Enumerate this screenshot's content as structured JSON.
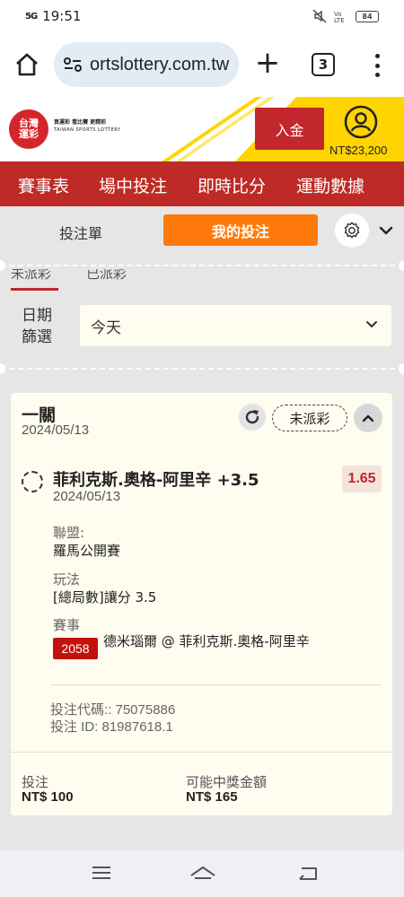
{
  "status_bar": {
    "signal": "5G",
    "time": "19:51",
    "battery": "84"
  },
  "browser": {
    "url": "ortslottery.com.tw",
    "tab_count": "3"
  },
  "header": {
    "logo_text": "台灣運彩",
    "tagline": "買運彩 看比賽 更精彩",
    "tagline_en": "TAIWAN SPORTS LOTTERY",
    "deposit_label": "入金",
    "balance": "NT$23,200"
  },
  "nav": {
    "items": [
      "賽事表",
      "場中投注",
      "即時比分",
      "運動數據"
    ]
  },
  "slip": {
    "bet_slip_label": "投注單",
    "my_bets_label": "我的投注",
    "subtab_unsettled": "未派彩",
    "subtab_settled": "已派彩"
  },
  "filter": {
    "label": "日期篩選",
    "value": "今天"
  },
  "bet": {
    "type": "一關",
    "date": "2024/05/13",
    "status": "未派彩",
    "selection": "菲利克斯.奧格-阿里辛 +3.5",
    "selection_date": "2024/05/13",
    "odds": "1.65",
    "league_label": "聯盟:",
    "league_value": "羅馬公開賽",
    "market_label": "玩法",
    "market_value": "[總局數]讓分 3.5",
    "event_label": "賽事",
    "event_code": "2058",
    "event_name": "德米瑙爾 @ 菲利克斯.奧格-阿里辛",
    "bet_code": "投注代碼:: 75075886",
    "bet_id": "投注 ID: 81987618.1",
    "stake_label": "投注",
    "stake_value": "NT$ 100",
    "payout_label": "可能中獎金額",
    "payout_value": "NT$ 165"
  },
  "colors": {
    "brand_red": "#be2a25",
    "accent_orange": "#ff7a0d",
    "header_yellow": "#ffd400"
  }
}
